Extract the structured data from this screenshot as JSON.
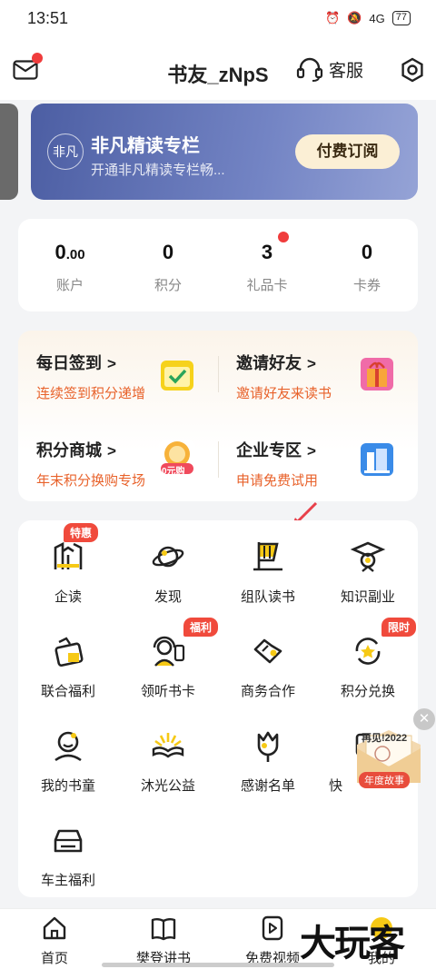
{
  "status": {
    "time": "13:51",
    "net": "4G",
    "battery": "77"
  },
  "header": {
    "username": "书友_zNpS",
    "service_label": "客服"
  },
  "banner": {
    "logo_text": "非凡",
    "title": "非凡精读专栏",
    "subtitle": "开通非凡精读专栏畅...",
    "button": "付费订阅"
  },
  "stats": [
    {
      "value": "0",
      "decimals": ".00",
      "label": "账户"
    },
    {
      "value": "0",
      "decimals": "",
      "label": "积分"
    },
    {
      "value": "3",
      "decimals": "",
      "label": "礼品卡"
    },
    {
      "value": "0",
      "decimals": "",
      "label": "卡券"
    }
  ],
  "quick": [
    {
      "title": "每日签到",
      "sub": "连续签到积分递增"
    },
    {
      "title": "邀请好友",
      "sub": "邀请好友来读书"
    },
    {
      "title": "积分商城",
      "sub": "年末积分换购专场",
      "icon_text": "0元购"
    },
    {
      "title": "企业专区",
      "sub": "申请免费试用"
    }
  ],
  "grid": [
    {
      "label": "企读",
      "badge": "特惠"
    },
    {
      "label": "发现"
    },
    {
      "label": "组队读书"
    },
    {
      "label": "知识副业"
    },
    {
      "label": "联合福利"
    },
    {
      "label": "领听书卡",
      "badge": "福利"
    },
    {
      "label": "商务合作"
    },
    {
      "label": "积分兑换",
      "badge": "限时"
    },
    {
      "label": "我的书童"
    },
    {
      "label": "沐光公益"
    },
    {
      "label": "感谢名单"
    },
    {
      "label": "快"
    },
    {
      "label": "车主福利"
    }
  ],
  "float_card": {
    "line1": "再见!2022",
    "line2": "年度故事"
  },
  "tabs": [
    {
      "label": "首页"
    },
    {
      "label": "樊登讲书"
    },
    {
      "label": "免费视频"
    },
    {
      "label": "我的"
    }
  ],
  "watermark": "大玩客"
}
